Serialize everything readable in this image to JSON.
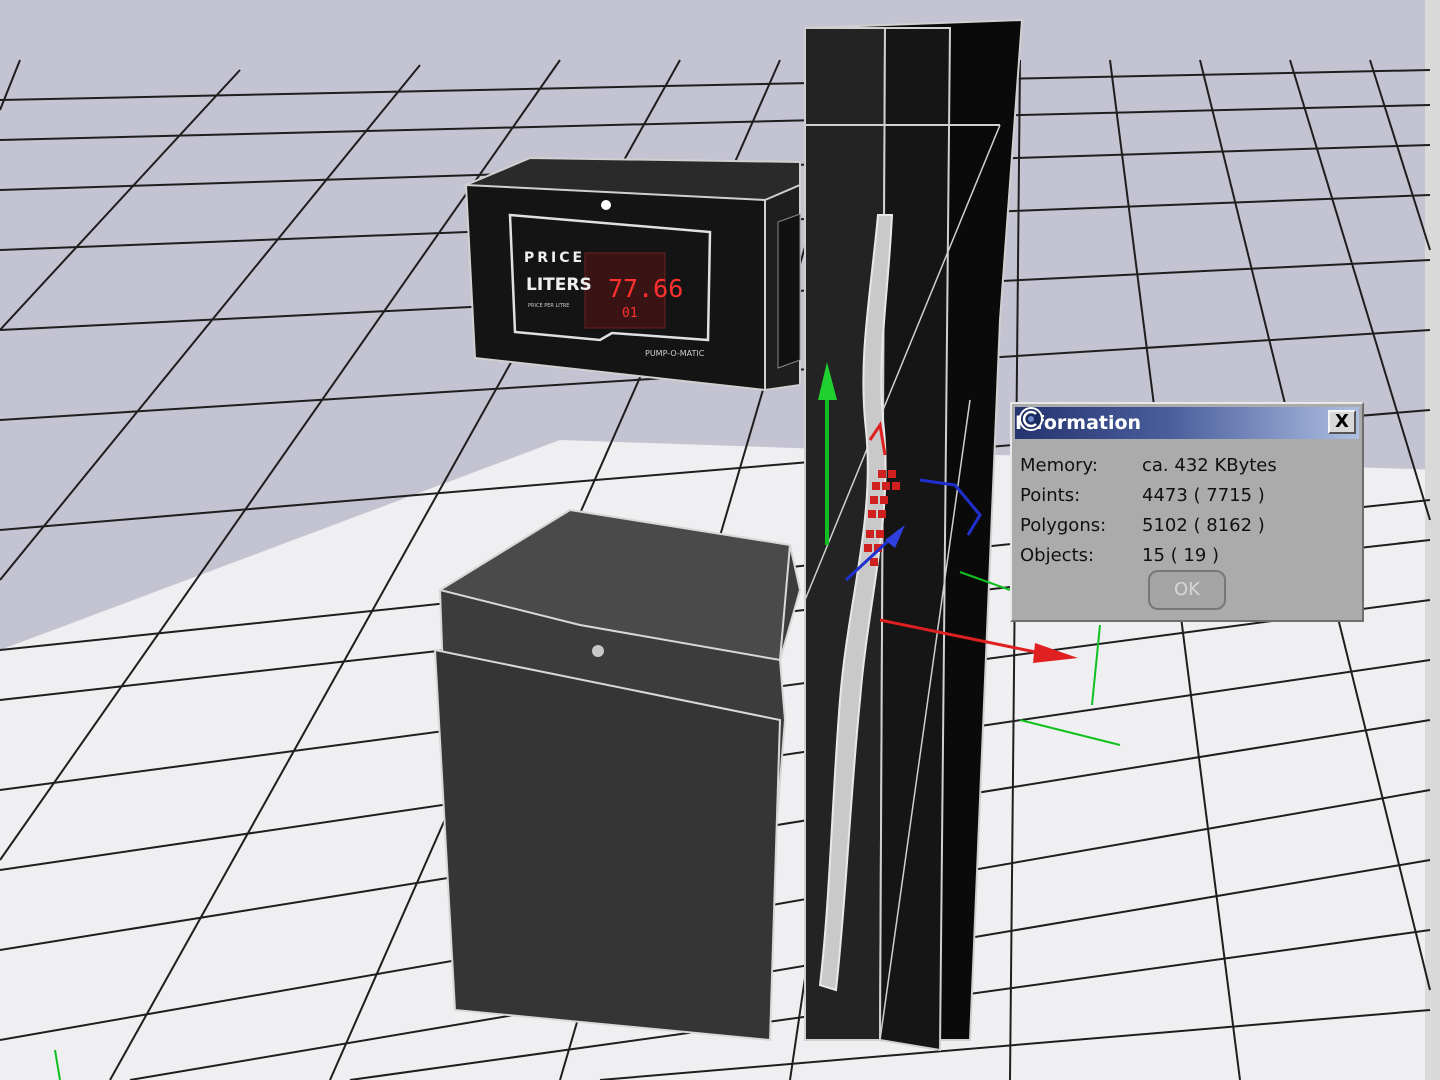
{
  "pump_display": {
    "label_price": "PRICE",
    "label_liters": "LITERS",
    "label_small": "PRICE PER LITRE",
    "price_value": "77.66",
    "liters_value": "01",
    "brand_text": "PUMP-O-MATIC"
  },
  "dialog": {
    "title": "Information",
    "close_label": "X",
    "rows": [
      {
        "label": "Memory:",
        "value": "ca. 432 KBytes"
      },
      {
        "label": "Points:",
        "value": "4473 ( 7715 )"
      },
      {
        "label": "Polygons:",
        "value": "5102 ( 8162 )"
      },
      {
        "label": "Objects:",
        "value": "15 ( 19 )"
      }
    ],
    "ok_label": "OK"
  },
  "colors": {
    "floor_light": "#efeef1",
    "floor_dark": "#bdbcca",
    "grid_line": "#1e1e1e",
    "model_body": "#444444",
    "model_dark": "#0b0b0b",
    "axis_x": "#e02020",
    "axis_y": "#10c020",
    "axis_z": "#2030d0",
    "title_start": "#25336f",
    "title_end": "#aebfe3"
  }
}
